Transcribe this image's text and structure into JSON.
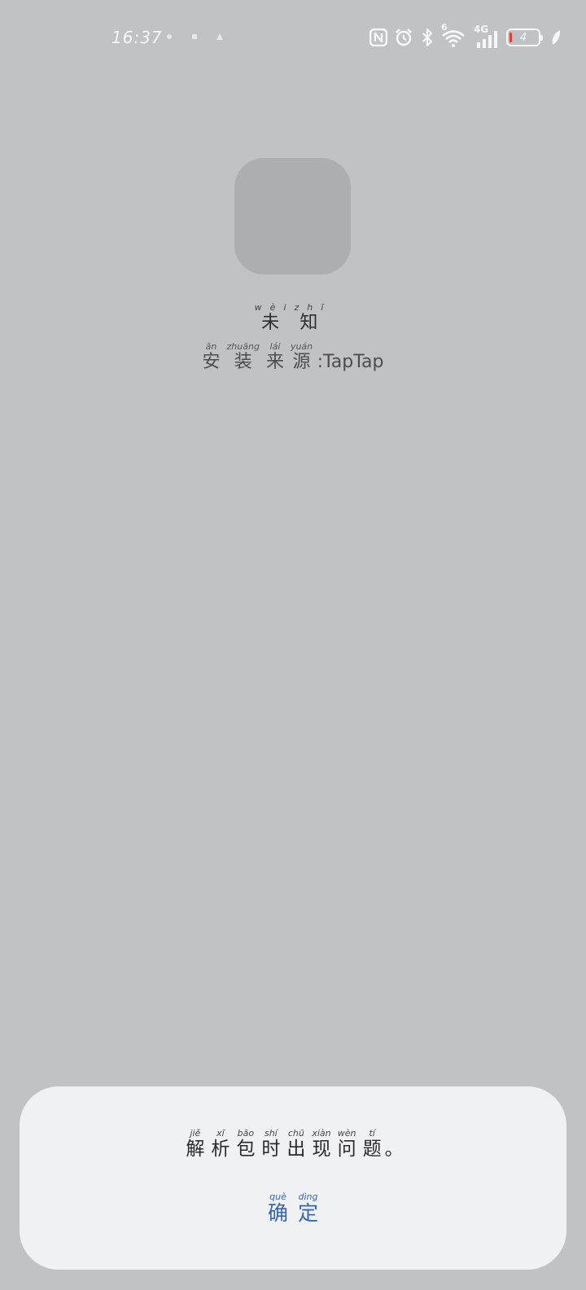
{
  "status_bar": {
    "time": "16:37",
    "network_label": "4G",
    "wifi_badge": "6",
    "battery_level": "4",
    "icons": [
      "nfc-icon",
      "alarm-icon",
      "bluetooth-icon",
      "wifi-icon",
      "cellular-signal-icon",
      "battery-icon",
      "leaf-icon"
    ]
  },
  "app": {
    "name_chars": [
      {
        "char": "未",
        "pinyin": "wèi"
      },
      {
        "char": "知",
        "pinyin": "zhī"
      }
    ],
    "source_label_chars": [
      {
        "char": "安",
        "pinyin": "ān"
      },
      {
        "char": "装",
        "pinyin": "zhuāng"
      },
      {
        "char": "来",
        "pinyin": "lái"
      },
      {
        "char": "源",
        "pinyin": "yuán"
      }
    ],
    "source_separator": ":",
    "source_value": "TapTap"
  },
  "dialog": {
    "message_chars": [
      {
        "char": "解",
        "pinyin": "jiě"
      },
      {
        "char": "析",
        "pinyin": "xī"
      },
      {
        "char": "包",
        "pinyin": "bāo"
      },
      {
        "char": "时",
        "pinyin": "shí"
      },
      {
        "char": "出",
        "pinyin": "chū"
      },
      {
        "char": "现",
        "pinyin": "xiàn"
      },
      {
        "char": "问",
        "pinyin": "wèn"
      },
      {
        "char": "题",
        "pinyin": "tí"
      }
    ],
    "message_end": "。",
    "confirm_chars": [
      {
        "char": "确",
        "pinyin": "què"
      },
      {
        "char": "定",
        "pinyin": "dìng"
      }
    ]
  },
  "colors": {
    "background": "#c1c2c4",
    "dialog_background": "#f0f1f2",
    "accent": "#3467b8"
  }
}
